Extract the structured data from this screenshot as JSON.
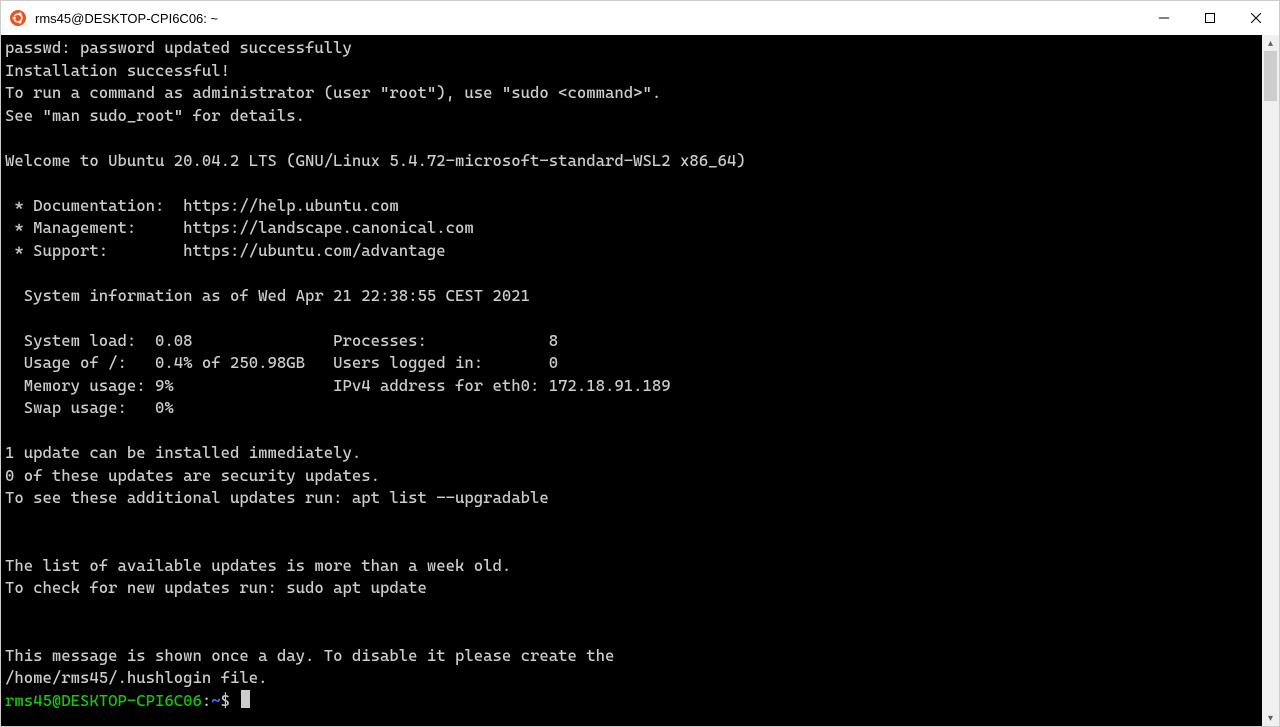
{
  "window": {
    "title": "rms45@DESKTOP-CPI6C06: ~",
    "icon": "ubuntu-icon"
  },
  "terminal": {
    "lines": [
      "passwd: password updated successfully",
      "Installation successful!",
      "To run a command as administrator (user \"root\"), use \"sudo <command>\".",
      "See \"man sudo_root\" for details.",
      "",
      "Welcome to Ubuntu 20.04.2 LTS (GNU/Linux 5.4.72-microsoft-standard-WSL2 x86_64)",
      "",
      " * Documentation:  https://help.ubuntu.com",
      " * Management:     https://landscape.canonical.com",
      " * Support:        https://ubuntu.com/advantage",
      "",
      "  System information as of Wed Apr 21 22:38:55 CEST 2021",
      "",
      "  System load:  0.08               Processes:             8",
      "  Usage of /:   0.4% of 250.98GB   Users logged in:       0",
      "  Memory usage: 9%                 IPv4 address for eth0: 172.18.91.189",
      "  Swap usage:   0%",
      "",
      "1 update can be installed immediately.",
      "0 of these updates are security updates.",
      "To see these additional updates run: apt list --upgradable",
      "",
      "",
      "The list of available updates is more than a week old.",
      "To check for new updates run: sudo apt update",
      "",
      "",
      "This message is shown once a day. To disable it please create the",
      "/home/rms45/.hushlogin file."
    ],
    "prompt": {
      "user_host": "rms45@DESKTOP-CPI6C06",
      "sep": ":",
      "path": "~",
      "symbol": "$"
    }
  }
}
